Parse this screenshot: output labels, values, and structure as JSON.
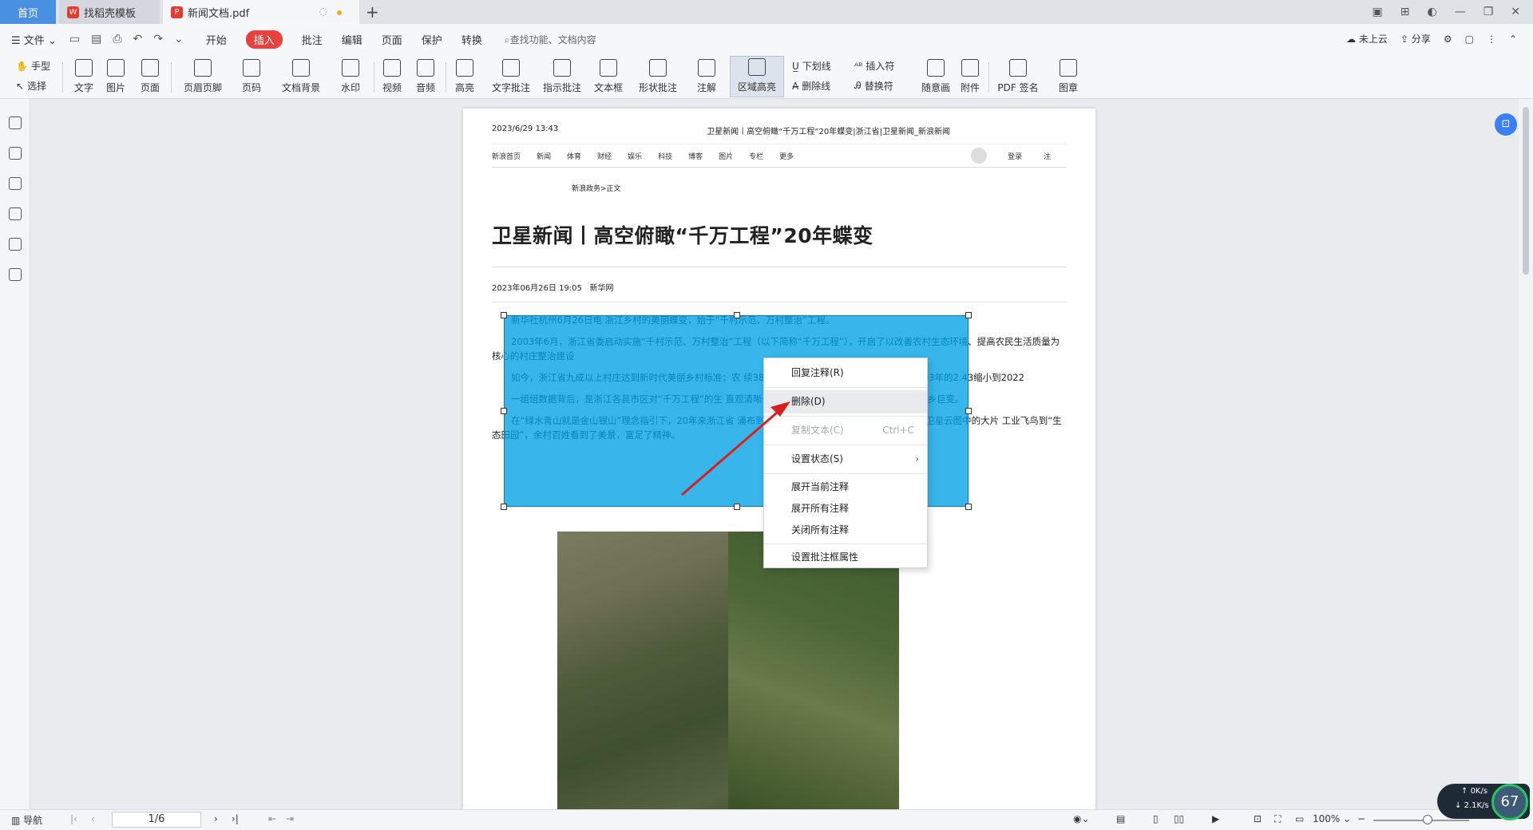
{
  "tabs": {
    "home": "首页",
    "template": "找稻壳模板",
    "document": "新闻文档.pdf"
  },
  "menu": {
    "file": "文件",
    "items": [
      "开始",
      "插入",
      "批注",
      "编辑",
      "页面",
      "保护",
      "转换"
    ],
    "active": "插入",
    "search_placeholder": "查找功能、文档内容",
    "cloud": "未上云",
    "share": "分享"
  },
  "ribbon": {
    "hand": "手型",
    "select": "选择",
    "text": "文字",
    "image": "图片",
    "page": "页面",
    "header_footer": "页眉页脚",
    "page_number": "页码",
    "doc_bg": "文档背景",
    "watermark": "水印",
    "video": "视频",
    "audio": "音频",
    "highlight": "高亮",
    "text_note": "文字批注",
    "pin_note": "指示批注",
    "textbox": "文本框",
    "shape_note": "形状批注",
    "annotation": "注解",
    "area_highlight": "区域高亮",
    "underline": "下划线",
    "strikethrough": "删除线",
    "insert_char": "插入符",
    "replace_char": "替换符",
    "freehand": "随意画",
    "attachment": "附件",
    "pdf_sign": "PDF 签名",
    "stamp": "图章"
  },
  "document": {
    "header_date": "2023/6/29 13:43",
    "header_title": "卫星新闻丨高空俯瞰“千万工程”20年蝶变|浙江省|卫星新闻_新浪新闻",
    "nav": [
      "新浪首页",
      "新闻",
      "体育",
      "财经",
      "娱乐",
      "科技",
      "博客",
      "图片",
      "专栏",
      "更多"
    ],
    "login": "登录",
    "note": "注",
    "breadcrumb": "新浪政务>正文",
    "title": "卫星新闻丨高空俯瞰“千万工程”20年蝶变",
    "date": "2023年06月26日 19:05",
    "source": "新华网",
    "paragraphs": [
      "新华社杭州6月26日电    浙江乡村的美丽蝶变，始于“千村示范、万村整治”工程。",
      "2003年6月，浙江省委启动实施“千村示范、万村整治”工程（以下简称“千万工程”），开启了以改善农村生态环境、提高农民生活质量为核心的村庄整治建设",
      "如今，浙江省九成以上村庄达到新时代美丽乡村标准；农                                                                   续38年领跑全国省区；城乡居民收入比从2003年的2.43缩小到2022",
      "一组组数据背后，是浙江各县市区对“千万工程”的生                                                                   直观清晰一起来看二十年来，卫星记录下的浙江山乡巨变。",
      "在“绿水青山就是金山银山”理念指引下，20年来浙江省                                                                   涌布到人在余村走、就是画中游”的精彩蝶变。卫星云图中的大片                                                                   工业飞鸟到“生态田园”，余村百姓看到了美景，富足了精神。"
    ]
  },
  "context_menu": {
    "reply": "回复注释(R)",
    "delete": "删除(D)",
    "copy_text": "复制文本(C)",
    "copy_shortcut": "Ctrl+C",
    "set_status": "设置状态(S)",
    "expand_current": "展开当前注释",
    "expand_all": "展开所有注释",
    "close_all": "关闭所有注释",
    "box_props": "设置批注框属性"
  },
  "status": {
    "nav_label": "导航",
    "page_indicator": "1/6",
    "zoom": "100%"
  },
  "net_widget": {
    "up": "0K/s",
    "down": "2.1K/s",
    "value": "67"
  }
}
